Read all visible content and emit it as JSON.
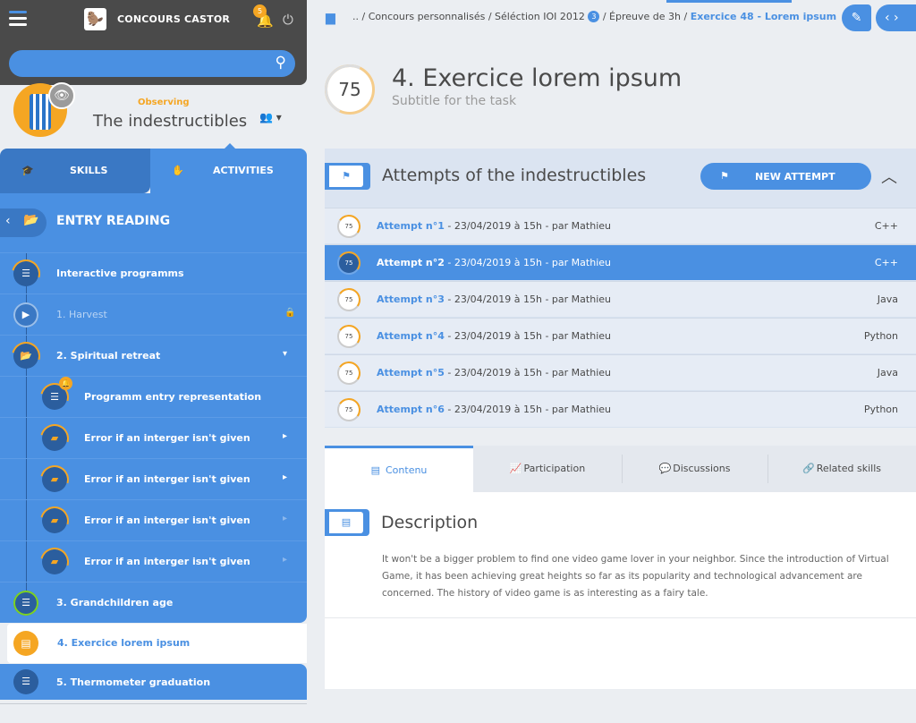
{
  "topbar": {
    "brand": "CONCOURS CASTOR",
    "notifications": "5",
    "search_placeholder": ""
  },
  "profile": {
    "status": "Observing",
    "team": "The indestructibles"
  },
  "left_tabs": {
    "skills": "SKILLS",
    "activities": "ACTIVITIES"
  },
  "tree": {
    "header": "ENTRY READING",
    "items": [
      {
        "label": "Interactive programms"
      },
      {
        "label": "1. Harvest"
      },
      {
        "label": "2. Spiritual retreat"
      },
      {
        "label": "Programm entry representation"
      },
      {
        "label": "Error if an interger isn't given"
      },
      {
        "label": "Error if an interger isn't given"
      },
      {
        "label": "Error if an interger isn't given"
      },
      {
        "label": "Error if an interger isn't given"
      },
      {
        "label": "3. Grandchildren age"
      },
      {
        "label": "4. Exercice lorem ipsum"
      },
      {
        "label": "5. Thermometer graduation"
      }
    ]
  },
  "breadcrumb": {
    "part1": ".. / Concours personnalisés / Séléction IOI 2012",
    "badge": "3",
    "part2": "/ Épreuve de 3h /",
    "current": "Exercice 48 - Lorem ipsum"
  },
  "task": {
    "score": "75",
    "title": "4. Exercice lorem ipsum",
    "subtitle": "Subtitle for the task"
  },
  "attempts": {
    "title": "Attempts of the indestructibles",
    "new_label": "NEW ATTEMPT",
    "rows": [
      {
        "score": "75",
        "name": "Attempt n°1",
        "meta": " - 23/04/2019 à 15h - par Mathieu",
        "lang": "C++"
      },
      {
        "score": "75",
        "name": "Attempt n°2",
        "meta": " - 23/04/2019 à 15h - par Mathieu",
        "lang": "C++"
      },
      {
        "score": "75",
        "name": "Attempt n°3",
        "meta": " - 23/04/2019 à 15h - par Mathieu",
        "lang": "Java"
      },
      {
        "score": "75",
        "name": "Attempt n°4",
        "meta": " - 23/04/2019 à 15h - par Mathieu",
        "lang": "Python"
      },
      {
        "score": "75",
        "name": "Attempt n°5",
        "meta": " - 23/04/2019 à 15h - par Mathieu",
        "lang": "Java"
      },
      {
        "score": "75",
        "name": "Attempt n°6",
        "meta": " - 23/04/2019 à 15h - par Mathieu",
        "lang": "Python"
      }
    ]
  },
  "content_tabs": [
    "Contenu",
    "Participation",
    "Discussions",
    "Related skills"
  ],
  "description": {
    "title": "Description",
    "text": "It won't be a bigger problem to find one video game lover in your neighbor. Since the introduction of Virtual Game, it has been achieving great heights so far as its popularity and technological advancement are concerned. The history of video game is as interesting as a fairy tale."
  },
  "colors": {
    "accent": "#4a90e2",
    "orange": "#f5a623",
    "dark": "#4a4a4a"
  }
}
